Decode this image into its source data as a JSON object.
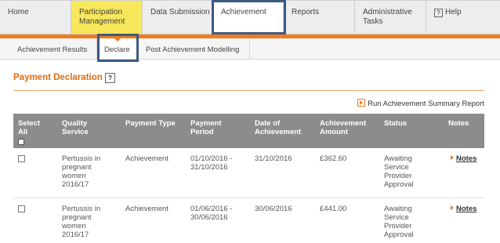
{
  "topnav": {
    "tabs": [
      {
        "label": "Home"
      },
      {
        "label": "Participation Management"
      },
      {
        "label": "Data Submission"
      },
      {
        "label": "Achievement"
      },
      {
        "label": "Reports"
      },
      {
        "label": "Administrative Tasks"
      },
      {
        "label": "Help",
        "icon": "?"
      }
    ]
  },
  "subnav": {
    "tabs": [
      {
        "label": "Achievement Results"
      },
      {
        "label": "Declare"
      },
      {
        "label": "Post Achievement Modelling"
      }
    ]
  },
  "page": {
    "title": "Payment Declaration",
    "help_icon": "?",
    "run_report_label": "Run Achievement Summary Report"
  },
  "table": {
    "headers": {
      "select_all": "Select All",
      "quality_service": "Quality Service",
      "payment_type": "Payment Type",
      "payment_period": "Payment Period",
      "date_of_achievement": "Date of Achievement",
      "achievement_amount": "Achievement Amount",
      "status": "Status",
      "notes": "Notes"
    },
    "rows": [
      {
        "quality_service": "Pertussis in pregnant women 2016/17",
        "payment_type": "Achievement",
        "payment_period": "01/10/2016 - 31/10/2016",
        "date_of_achievement": "31/10/2016",
        "achievement_amount": "£362.60",
        "status": "Awaiting Service Provider Approval",
        "notes": "Notes"
      },
      {
        "quality_service": "Pertussis in pregnant women 2016/17",
        "payment_type": "Achievement",
        "payment_period": "01/06/2016 - 30/06/2016",
        "date_of_achievement": "30/06/2016",
        "achievement_amount": "£441.00",
        "status": "Awaiting Service Provider Approval",
        "notes": "Notes"
      }
    ]
  },
  "colors": {
    "accent_orange": "#f07c1f",
    "active_yellow": "#f7e75c",
    "header_grey": "#8c8c8c",
    "highlight_blue": "#3c5a82"
  }
}
